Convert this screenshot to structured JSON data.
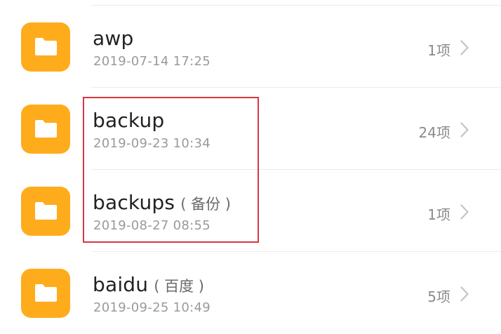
{
  "folders": [
    {
      "name": "awp",
      "alias": "",
      "date": "2019-07-14 17:25",
      "count": "1项"
    },
    {
      "name": "backup",
      "alias": "",
      "date": "2019-09-23 10:34",
      "count": "24项"
    },
    {
      "name": "backups",
      "alias": "( 备份 )",
      "date": "2019-08-27 08:55",
      "count": "1项"
    },
    {
      "name": "baidu",
      "alias": "( 百度 )",
      "date": "2019-09-25 10:49",
      "count": "5项"
    }
  ],
  "icons": {
    "folder": "folder-icon",
    "chevron": "chevron-right-icon"
  },
  "colors": {
    "folder_accent": "#ffac1c",
    "highlight_border": "#d9363e"
  }
}
